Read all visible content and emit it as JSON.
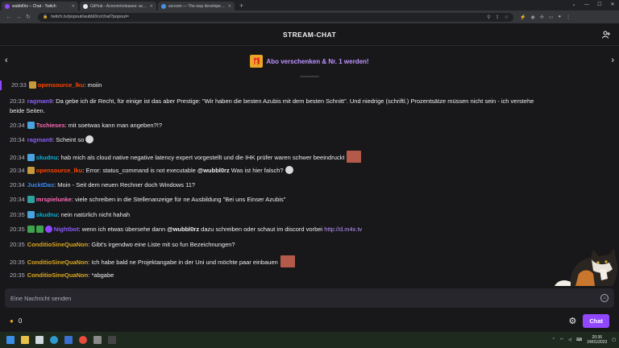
{
  "browser": {
    "tabs": [
      {
        "title": "wubbl0rz – Chat - Twitch",
        "color": "#9147ff"
      },
      {
        "title": "GitHub - Acreom/releases: acreo...",
        "color": "#e8eaed"
      },
      {
        "title": "acreom — The way developers g...",
        "color": "#4a90e2"
      }
    ],
    "new_tab": "+",
    "url": "twitch.tv/popout/wubbl0rz/chat?popout="
  },
  "chat": {
    "title": "STREAM-CHAT",
    "promo": "Abo verschenken & Nr. 1 werden!",
    "messages": [
      {
        "time": "20:33",
        "user": "opensource_lku",
        "color": "#ff4500",
        "badges": [
          "#c89a3c"
        ],
        "text": ": moiin"
      },
      {
        "time": "20:33",
        "user": "ragman9",
        "color": "#8a5cf5",
        "badges": [],
        "text": ": Da gebe ich dir Recht, für einige ist das aber Prestige: \"Wir haben die besten Azubis mit dem besten Schnitt\". Und niedrige (schriftl.) Prozentsätze müssen nicht sein - ich verstehe",
        "text2": "beide Seiten."
      },
      {
        "time": "20:34",
        "user": "Tschieses",
        "color": "#ff69b4",
        "badges": [
          "#4aa3df"
        ],
        "text": ": mit soetwas kann man angeben?!?"
      },
      {
        "time": "20:34",
        "user": "ragman9",
        "color": "#8a5cf5",
        "badges": [],
        "text": ": Scheint so"
      },
      {
        "time": "20:34",
        "user": "skudnu",
        "color": "#00b5d8",
        "badges": [
          "#4aa3df"
        ],
        "text": ": hab mich als cloud native negative latency expert vorgestellt und die IHK prüfer waren schwer beeindruckt"
      },
      {
        "time": "20:34",
        "user": "opensource_lku",
        "color": "#ff4500",
        "badges": [
          "#c89a3c"
        ],
        "text": ": Error: status_command is not executable ",
        "mention": "@wubbl0rz",
        "text_after": " Was ist hier falsch?"
      },
      {
        "time": "20:34",
        "user": "JucktDas",
        "color": "#3d8af7",
        "badges": [],
        "text": ": Moin - Seit dem neuen Rechner doch Windows 11?"
      },
      {
        "time": "20:34",
        "user": "mrspielunke",
        "color": "#ff69b4",
        "badges": [
          "#2fa0a0"
        ],
        "text": ": viele schreiben in die Stellenanzeige für ne Ausbildung \"Bei uns Einser Azubis\""
      },
      {
        "time": "20:35",
        "user": "skudnu",
        "color": "#00b5d8",
        "badges": [
          "#4aa3df"
        ],
        "text": ": nein natürlich nicht hahah"
      },
      {
        "time": "20:35",
        "user": "Nightbot",
        "color": "#8a5cf5",
        "badges": [
          "#3fa34d",
          "#3fa34d",
          "#9147ff"
        ],
        "text": ": wenn ich etwas übersehe dann ",
        "mention": "@wubbl0rz",
        "text_after": " dazu schreiben oder schaut im discord vorbei ",
        "link": "http://d.m4x.tv"
      },
      {
        "time": "20:35",
        "user": "ConditioSineQuaNon",
        "color": "#daa520",
        "badges": [],
        "text": ": Gibt's irgendwo eine Liste mit so fun Bezeichnungen?"
      },
      {
        "time": "20:35",
        "user": "ConditioSineQuaNon",
        "color": "#daa520",
        "badges": [],
        "text": ": Ich habe bald ne Projektangabe in der Uni und möchte paar einbauen"
      },
      {
        "time": "20:35",
        "user": "ConditioSineQuaNon",
        "color": "#daa520",
        "badges": [],
        "text": ": *abgabe"
      }
    ],
    "input_placeholder": "Eine Nachricht senden",
    "points": "0",
    "send_label": "Chat"
  },
  "taskbar": {
    "time": "20:36",
    "date": "24/01/2023"
  }
}
